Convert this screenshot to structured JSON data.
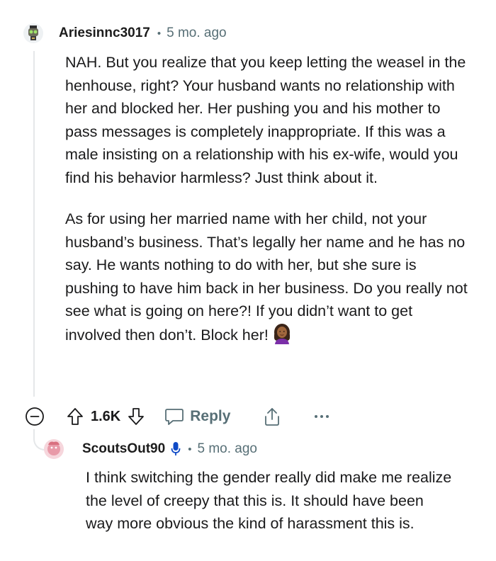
{
  "comment": {
    "author": "Ariesinnc3017",
    "separator": "•",
    "age": "5 mo. ago",
    "paragraph1": "NAH. But you realize that you keep letting the weasel in the henhouse, right? Your husband wants no relationship with her and blocked her. Her pushing you and his mother to pass messages is completely inappropriate. If this was a male insisting on a relationship with his ex-wife, would you find his behavior harmless? Just think about it.",
    "paragraph2": "As for using her married name with her child, not your husband’s business. That’s legally her name and he has no say. He wants nothing to do with her, but she sure is pushing to have him back in her business. Do you really not see what is going on here?! If you didn’t want to get involved then don’t. Block her!",
    "actions": {
      "collapse_icon": "collapse-minus-icon",
      "upvote_icon": "upvote-arrow-icon",
      "vote_count": "1.6K",
      "downvote_icon": "downvote-arrow-icon",
      "reply_icon": "speech-bubble-icon",
      "reply_label": "Reply",
      "share_icon": "share-icon",
      "more_icon": "more-dots-icon"
    }
  },
  "reply": {
    "author": "ScoutsOut90",
    "separator": "•",
    "age": "5 mo. ago",
    "text": "I think switching the gender really did make me realize the level of creepy that this is. It should have been way more obvious the kind of harassment this is."
  },
  "colors": {
    "text": "#1a1a1b",
    "muted": "#576f76",
    "thread_line": "#e5e7e9",
    "mic_icon": "#0f4ac6"
  }
}
